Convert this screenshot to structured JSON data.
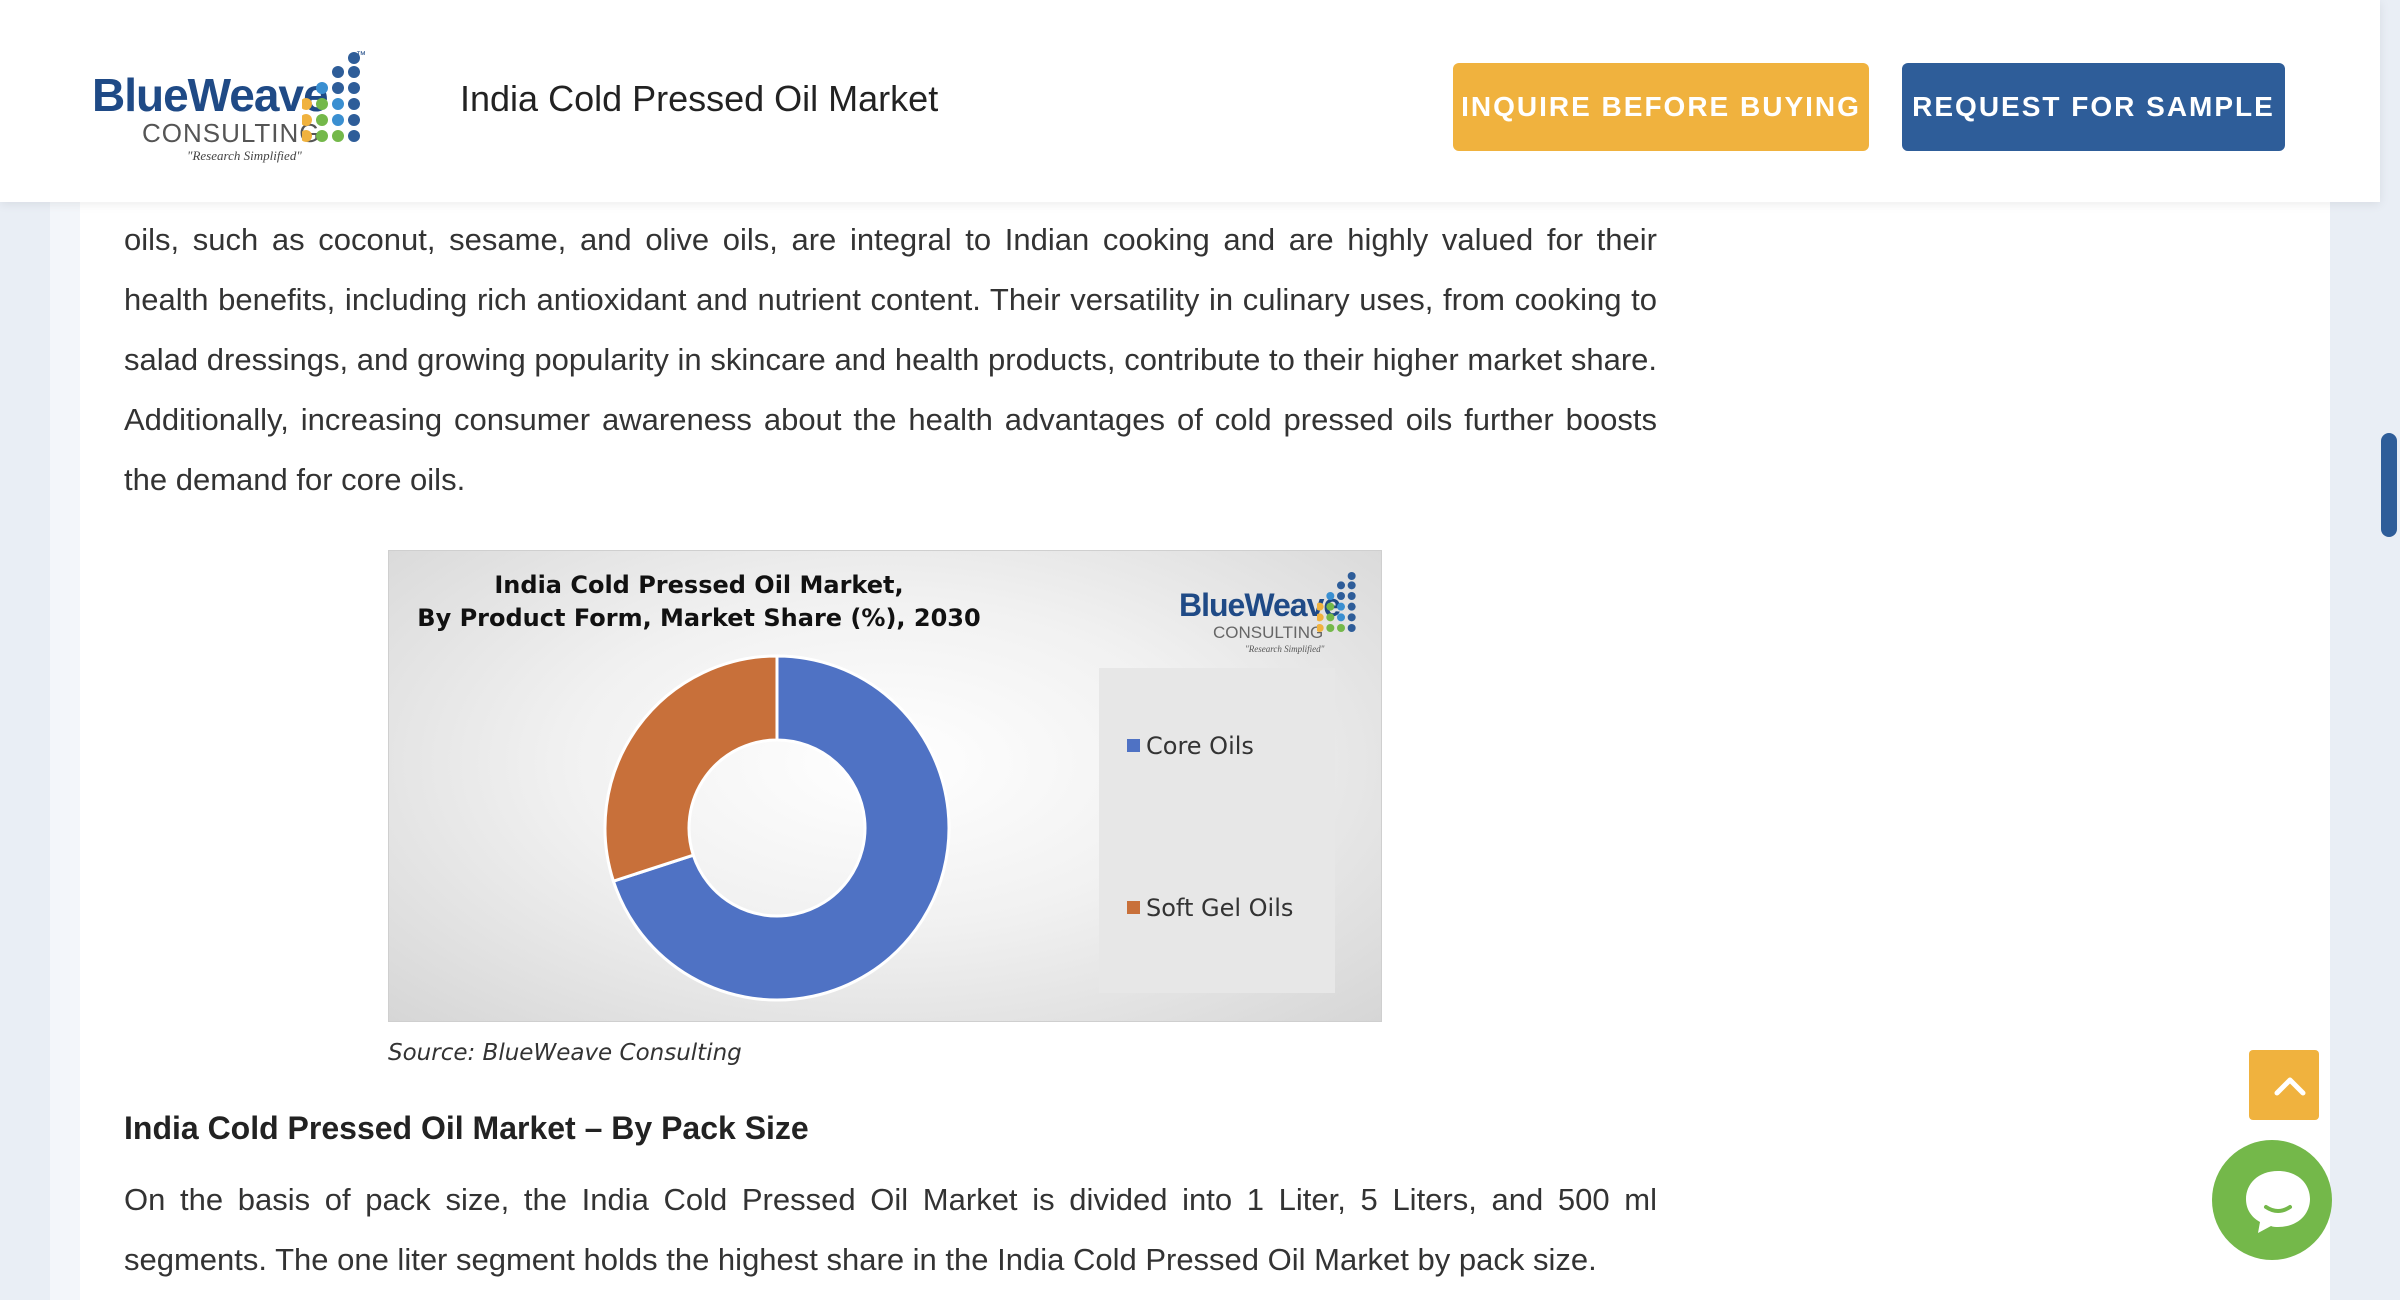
{
  "header": {
    "logo": {
      "main": "BlueWeave",
      "sub": "CONSULTING",
      "tagline": "\"Research Simplified\"",
      "tm": "™"
    },
    "title": "India Cold Pressed Oil Market",
    "inquire_label": "INQUIRE BEFORE BUYING",
    "sample_label": "REQUEST FOR SAMPLE"
  },
  "article": {
    "paragraph1": "oils, such as coconut, sesame, and olive oils, are integral to Indian cooking and are highly valued for their health benefits, including rich antioxidant and nutrient content. Their versatility in culinary uses, from cooking to salad dressings, and growing popularity in skincare and health products, contribute to their higher market share. Additionally, increasing consumer awareness about the health advantages of cold pressed oils further boosts the demand for core oils.",
    "section_heading": "India Cold Pressed Oil Market – By Pack Size",
    "paragraph2": "On the basis of pack size, the India Cold Pressed Oil Market is divided into 1 Liter, 5 Liters, and 500 ml segments. The one liter segment holds the highest share in the India Cold Pressed Oil Market by pack size."
  },
  "chart_data": {
    "type": "pie",
    "variant": "donut",
    "title_line1": "India Cold Pressed Oil Market,",
    "title_line2": "By Product Form, Market Share (%), 2030",
    "categories": [
      "Core Oils",
      "Soft Gel Oils"
    ],
    "values": [
      70,
      30
    ],
    "colors": [
      "#4f72c4",
      "#c8703a"
    ],
    "legend_position": "right",
    "source": "Source: BlueWeave Consulting",
    "logo": {
      "main": "BlueWeave",
      "sub": "CONSULTING",
      "tagline": "\"Research Simplified\""
    }
  },
  "colors": {
    "brand_blue": "#2e5d99",
    "brand_orange": "#f0b23e",
    "chat_green": "#74b84a"
  },
  "icons": {
    "scroll_top": "chevron-up-icon",
    "chat": "chat-bubble-icon"
  }
}
